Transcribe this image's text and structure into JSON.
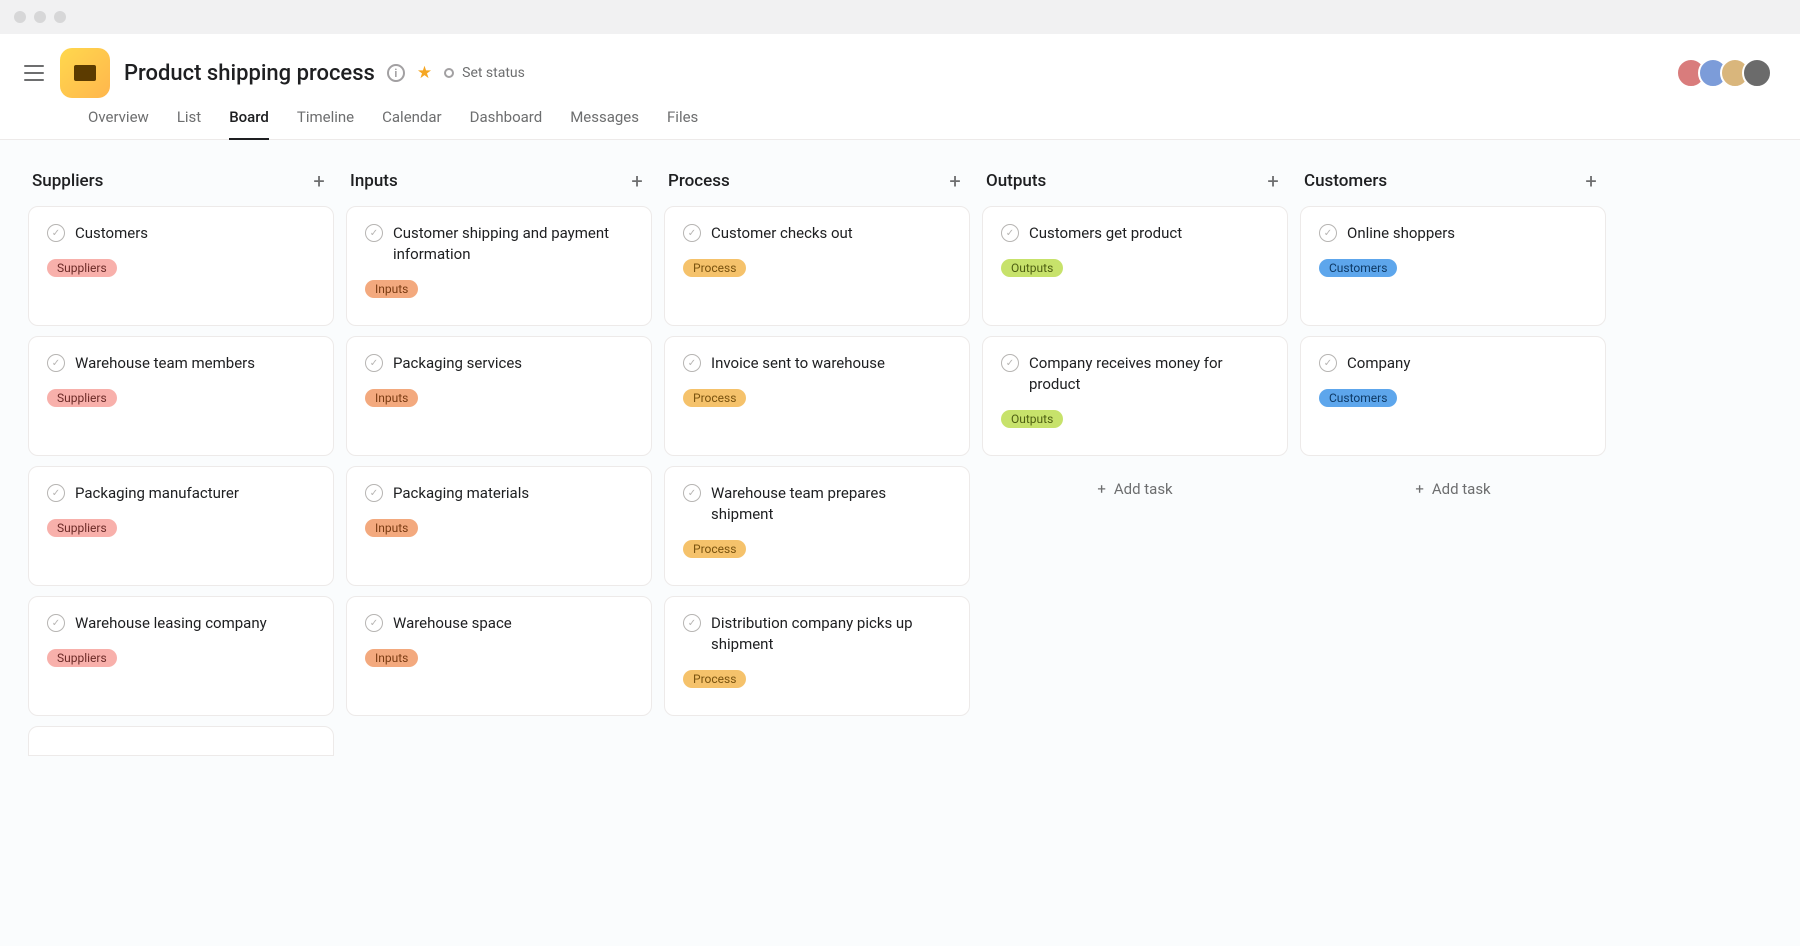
{
  "project": {
    "title": "Product shipping process",
    "status_label": "Set status"
  },
  "tabs": [
    {
      "label": "Overview",
      "active": false
    },
    {
      "label": "List",
      "active": false
    },
    {
      "label": "Board",
      "active": true
    },
    {
      "label": "Timeline",
      "active": false
    },
    {
      "label": "Calendar",
      "active": false
    },
    {
      "label": "Dashboard",
      "active": false
    },
    {
      "label": "Messages",
      "active": false
    },
    {
      "label": "Files",
      "active": false
    }
  ],
  "add_task_label": "Add task",
  "avatar_colors": [
    "#d97c7c",
    "#7c9cd9",
    "#d9b67c",
    "#6b6b6b"
  ],
  "columns": [
    {
      "title": "Suppliers",
      "cards": [
        {
          "title": "Customers",
          "tag": "Suppliers"
        },
        {
          "title": "Warehouse team members",
          "tag": "Suppliers"
        },
        {
          "title": "Packaging manufacturer",
          "tag": "Suppliers"
        },
        {
          "title": "Warehouse leasing company",
          "tag": "Suppliers"
        }
      ],
      "partial_card": true,
      "show_add": false
    },
    {
      "title": "Inputs",
      "cards": [
        {
          "title": "Customer shipping and payment information",
          "tag": "Inputs"
        },
        {
          "title": "Packaging services",
          "tag": "Inputs"
        },
        {
          "title": "Packaging materials",
          "tag": "Inputs"
        },
        {
          "title": "Warehouse space",
          "tag": "Inputs"
        }
      ],
      "partial_card": false,
      "show_add": false
    },
    {
      "title": "Process",
      "cards": [
        {
          "title": "Customer checks out",
          "tag": "Process"
        },
        {
          "title": "Invoice sent to warehouse",
          "tag": "Process"
        },
        {
          "title": "Warehouse team prepares shipment",
          "tag": "Process"
        },
        {
          "title": "Distribution company picks up shipment",
          "tag": "Process"
        }
      ],
      "partial_card": false,
      "show_add": false
    },
    {
      "title": "Outputs",
      "cards": [
        {
          "title": "Customers get product",
          "tag": "Outputs"
        },
        {
          "title": "Company receives money for product",
          "tag": "Outputs"
        }
      ],
      "partial_card": false,
      "show_add": true
    },
    {
      "title": "Customers",
      "cards": [
        {
          "title": "Online shoppers",
          "tag": "Customers"
        },
        {
          "title": "Company",
          "tag": "Customers"
        }
      ],
      "partial_card": false,
      "show_add": true
    }
  ]
}
